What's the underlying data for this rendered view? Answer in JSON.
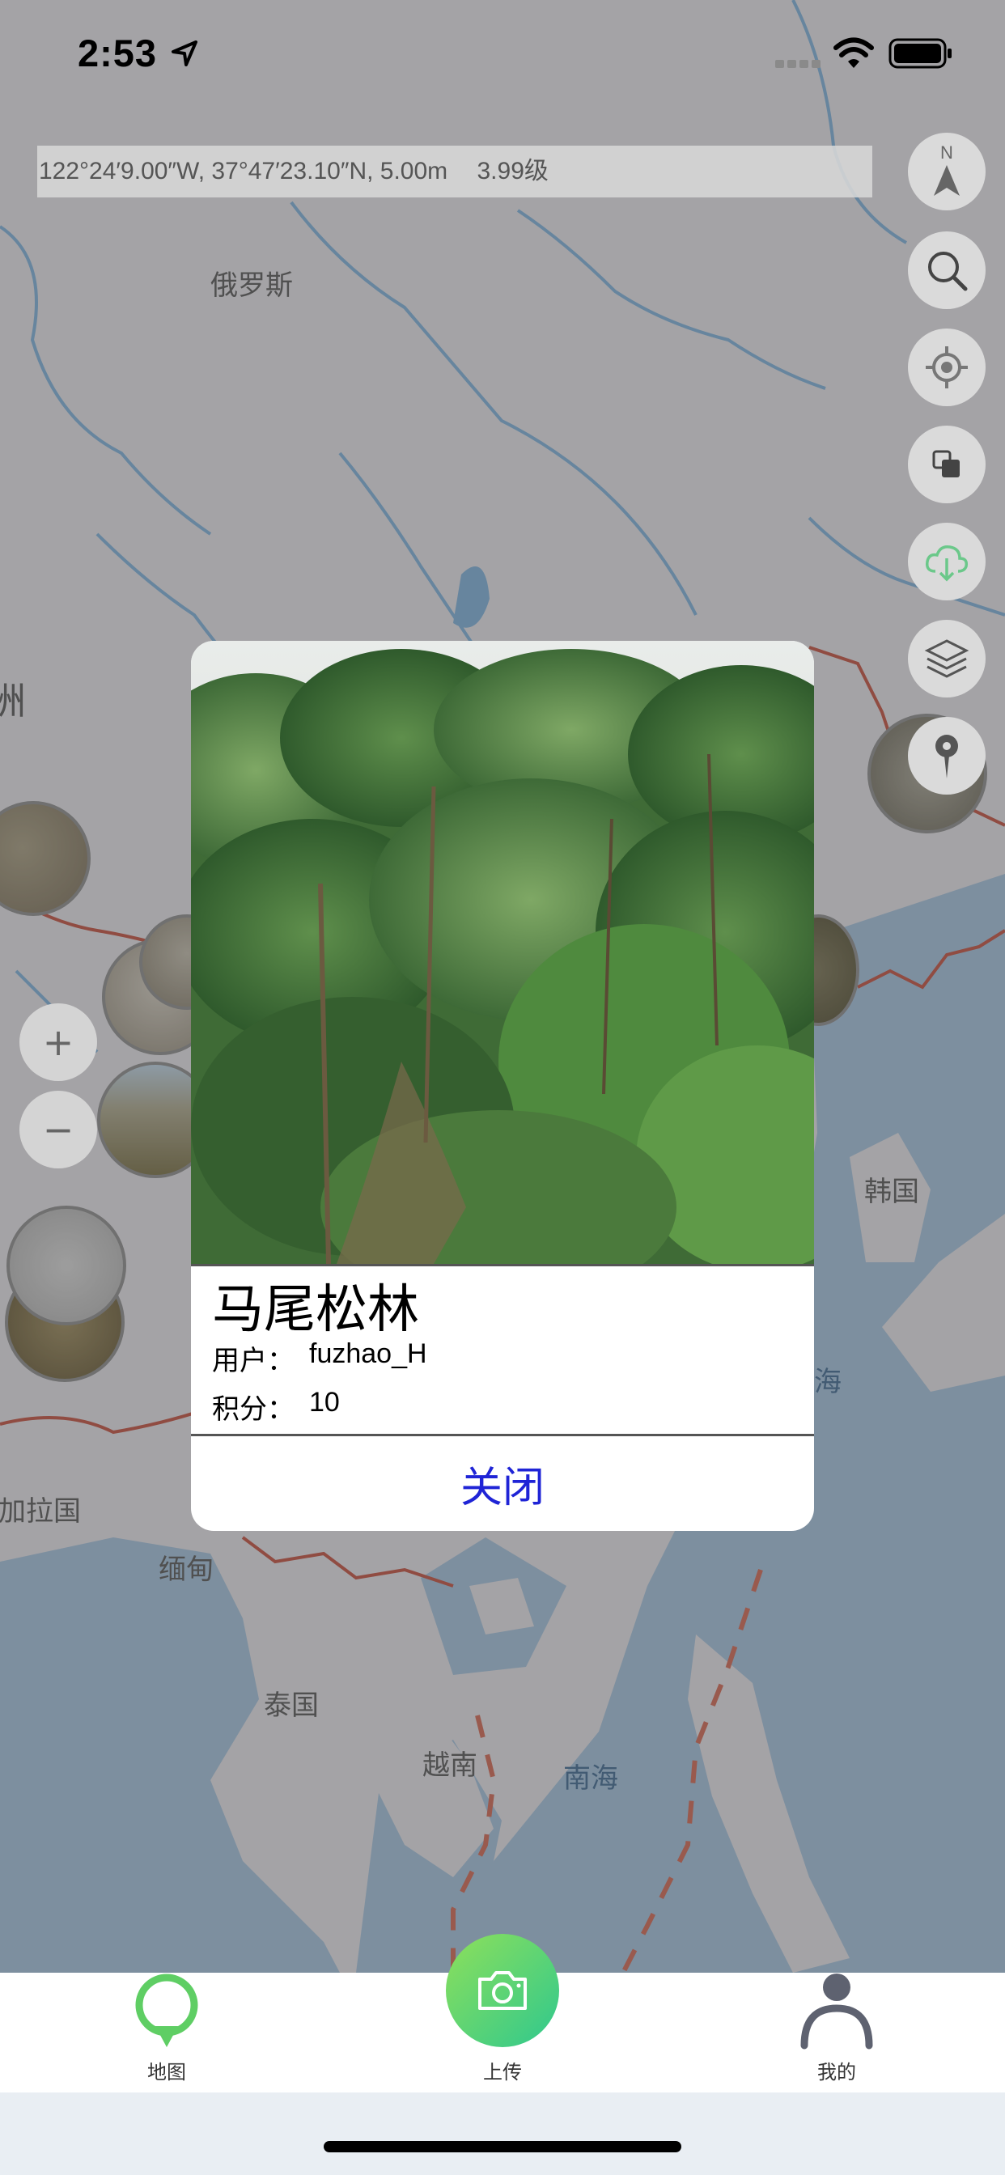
{
  "status_bar": {
    "time": "2:53"
  },
  "map": {
    "coordinate_readout": {
      "position": "122°24′9.00″W, 37°47′23.10″N, 5.00m",
      "zoom": "3.99级"
    },
    "labels": {
      "russia": "俄罗斯",
      "korea": "韩国",
      "sea_partial": "海",
      "bangladesh_partial": "孟加拉国",
      "myanmar": "缅甸",
      "thailand": "泰国",
      "vietnam": "越南",
      "south_china_sea": "南海",
      "left_edge_partial": "洲"
    },
    "controls": {
      "north_arrow_label": "N",
      "zoom_in": "+",
      "zoom_out": "−"
    }
  },
  "popup": {
    "title": "马尾松林",
    "user_label": "用户：",
    "user_value": "fuzhao_H",
    "score_label": "积分：",
    "score_value": "10",
    "close_label": "关闭"
  },
  "tabbar": {
    "items": [
      {
        "label": "地图"
      },
      {
        "label": "上传"
      },
      {
        "label": "我的"
      }
    ]
  },
  "colors": {
    "tab_green": "#5fce64",
    "upload_gradient_start": "#8ee05a",
    "upload_gradient_end": "#2fc88e",
    "close_text": "#1f24d6",
    "border_line": "#c86a5c"
  }
}
